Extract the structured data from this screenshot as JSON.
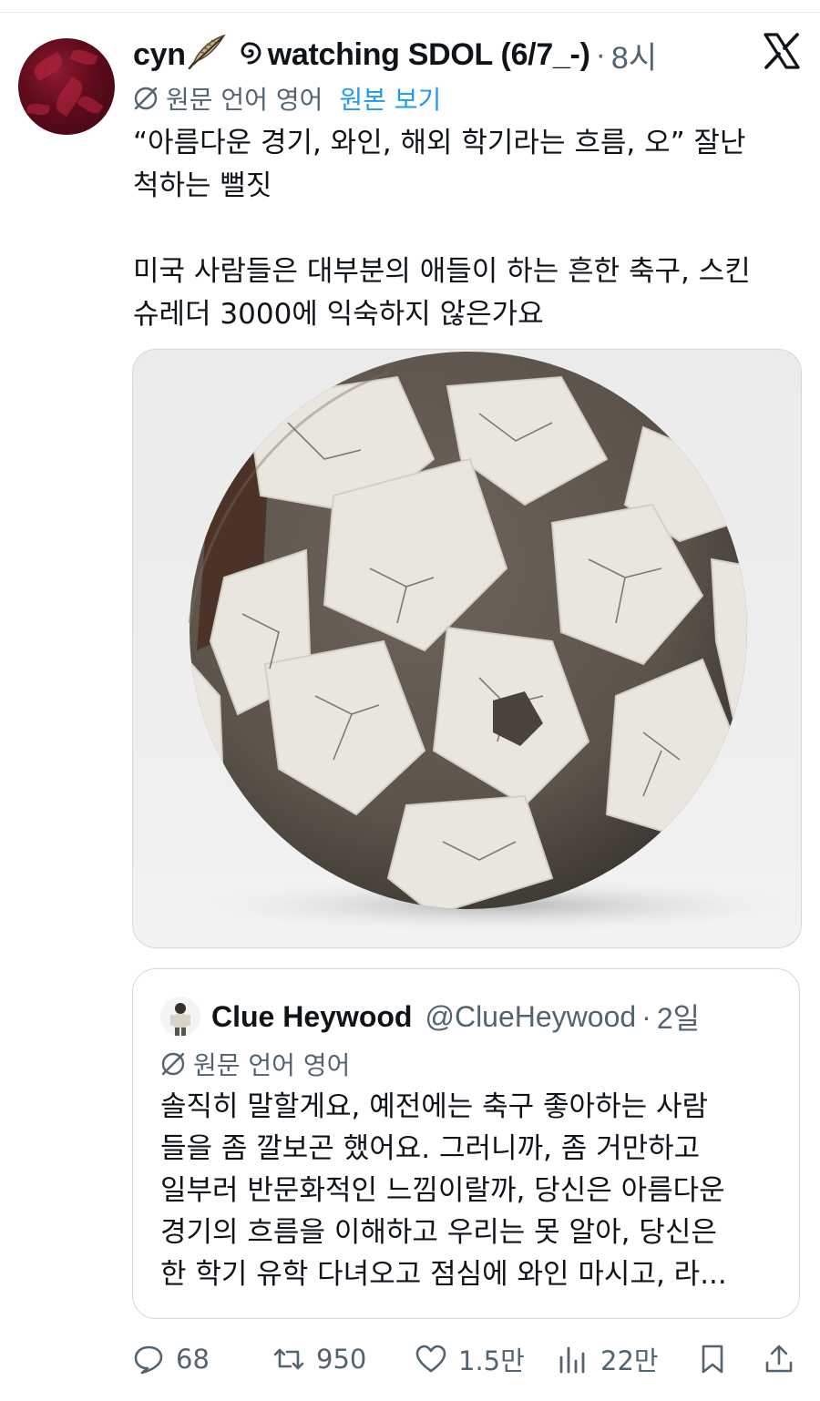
{
  "tweet": {
    "display_name": "cyn",
    "status_text": "watching SDOL (6/7_-)",
    "separator": "·",
    "time": "8시",
    "translation": {
      "label": "원문 언어 영어",
      "show_original": "원본 보기"
    },
    "text_lines": [
      "“아름다운 경기, 와인, 해외 학기라는 흐름, 오” 잘난",
      "척하는 뻘짓",
      "미국 사람들은 대부분의 애들이 하는 흔한 축구, 스킨",
      "슈레더 3000에 익숙하지 않은가요"
    ],
    "media": {
      "icon": "worn-soccer-ball-image"
    }
  },
  "quote": {
    "name": "Clue Heywood",
    "handle": "@ClueHeywood",
    "separator": "·",
    "time": "2일",
    "translation_label": "원문 언어 영어",
    "text_lines": [
      "솔직히 말할게요, 예전에는 축구 좋아하는 사람",
      "들을 좀 깔보곤 했어요. 그러니까, 좀 거만하고",
      "일부러 반문화적인 느낌이랄까, 당신은 아름다운",
      "경기의 흐름을 이해하고 우리는 못 알아, 당신은",
      "한 학기 유학 다녀오고 점심에 와인 마시고, 라..."
    ]
  },
  "actions": {
    "replies": "68",
    "retweets": "950",
    "likes": "1.5만",
    "views": "22만"
  },
  "colors": {
    "text": "#0f1419",
    "secondary": "#536471",
    "link": "#1d9bf0",
    "border": "#cfd9de",
    "avatar": "#6b0f22"
  }
}
